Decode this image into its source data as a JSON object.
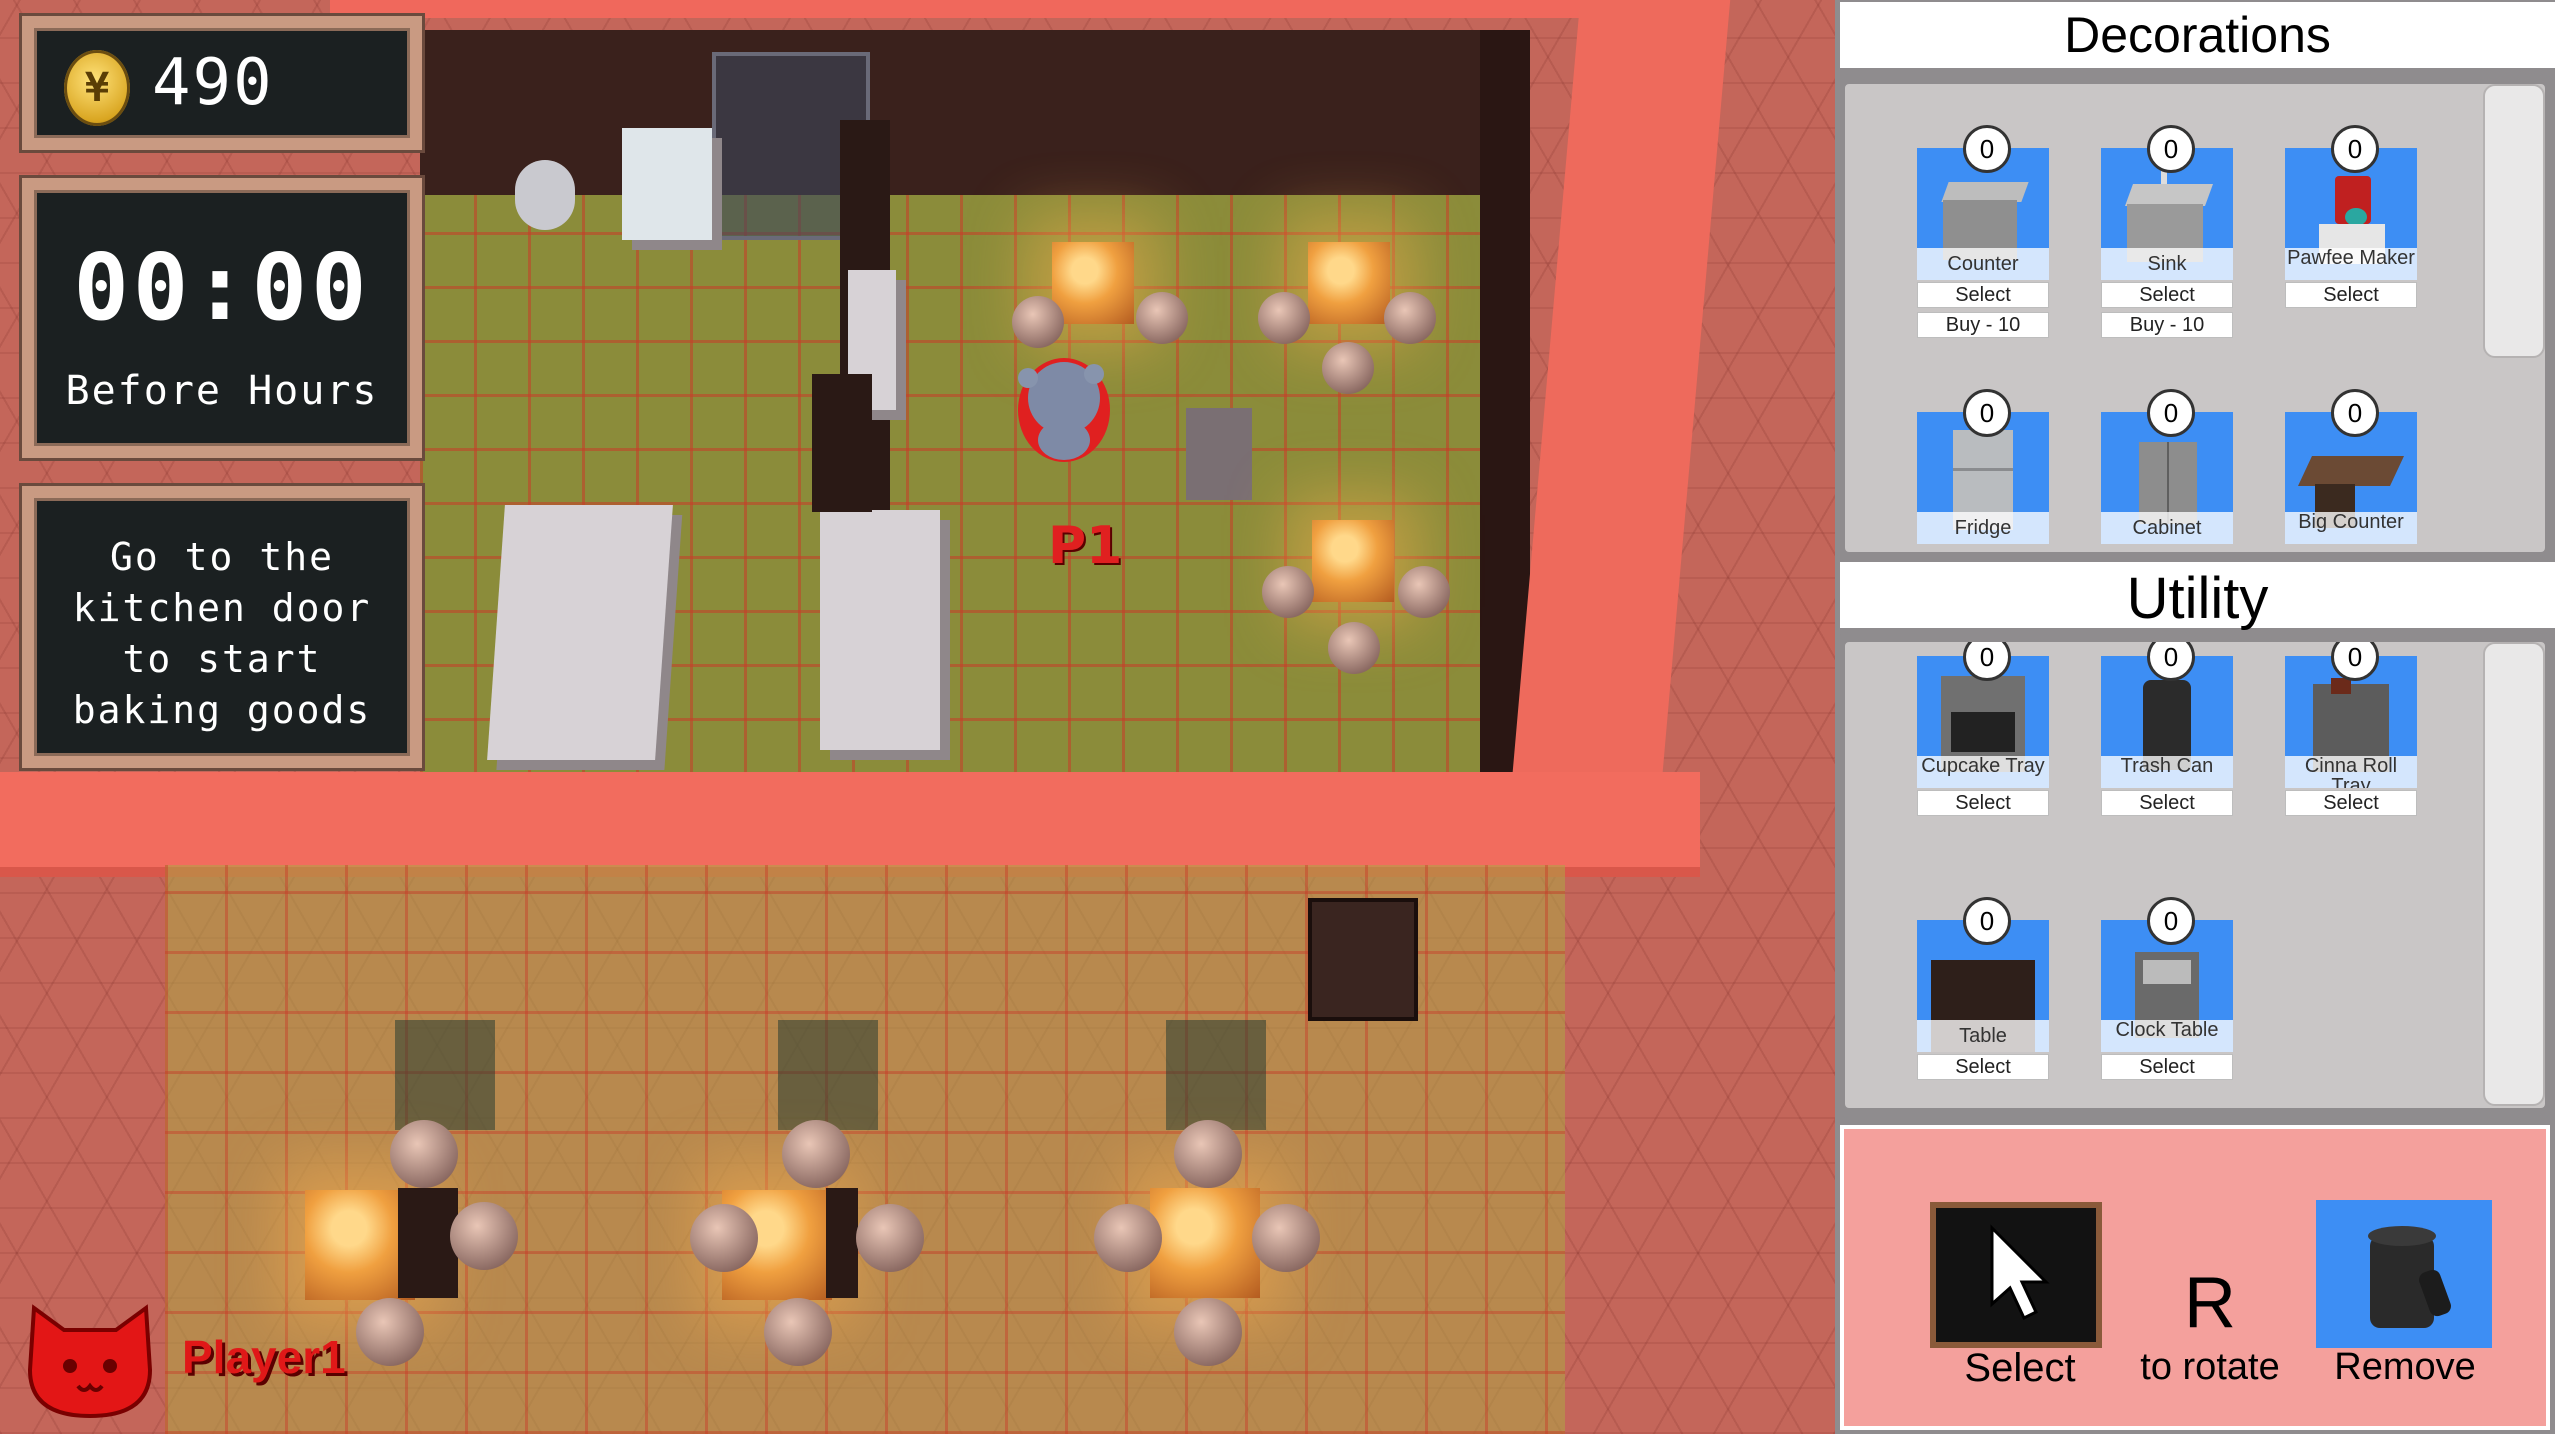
{
  "hud": {
    "money": "490",
    "clock_time": "00:00",
    "clock_phase": "Before Hours",
    "hint": "Go to the kitchen door to start baking goods",
    "player_name": "Player1",
    "player_marker": "P1"
  },
  "decorations": {
    "title": "Decorations",
    "items": [
      {
        "name": "Counter",
        "count": "0",
        "select": "Select",
        "buy": "Buy - 10"
      },
      {
        "name": "Sink",
        "count": "0",
        "select": "Select",
        "buy": "Buy - 10"
      },
      {
        "name": "Pawfee Maker",
        "count": "0",
        "select": "Select"
      },
      {
        "name": "Fridge",
        "count": "0"
      },
      {
        "name": "Cabinet",
        "count": "0"
      },
      {
        "name": "Big Counter",
        "count": "0"
      }
    ]
  },
  "utility": {
    "title": "Utility",
    "items": [
      {
        "name": "Cupcake Tray",
        "count": "0",
        "select": "Select"
      },
      {
        "name": "Trash Can",
        "count": "0",
        "select": "Select"
      },
      {
        "name": "Cinna Roll Tray",
        "count": "0",
        "select": "Select"
      },
      {
        "name": "Table",
        "count": "0",
        "select": "Select"
      },
      {
        "name": "Clock Table",
        "count": "0",
        "select": "Select"
      }
    ]
  },
  "tools": {
    "select_label": "Select",
    "rotate_key": "R",
    "rotate_label": "to rotate",
    "remove_label": "Remove"
  },
  "colors": {
    "card_bg": "#3d8ef4",
    "tool_bar_bg": "#f4a09c",
    "player_red": "#e01818"
  },
  "icons": {
    "coin": "coin-icon",
    "player_avatar": "cat-face-icon",
    "select_tool": "cursor-arrow-icon",
    "remove_tool": "trash-can-icon"
  }
}
